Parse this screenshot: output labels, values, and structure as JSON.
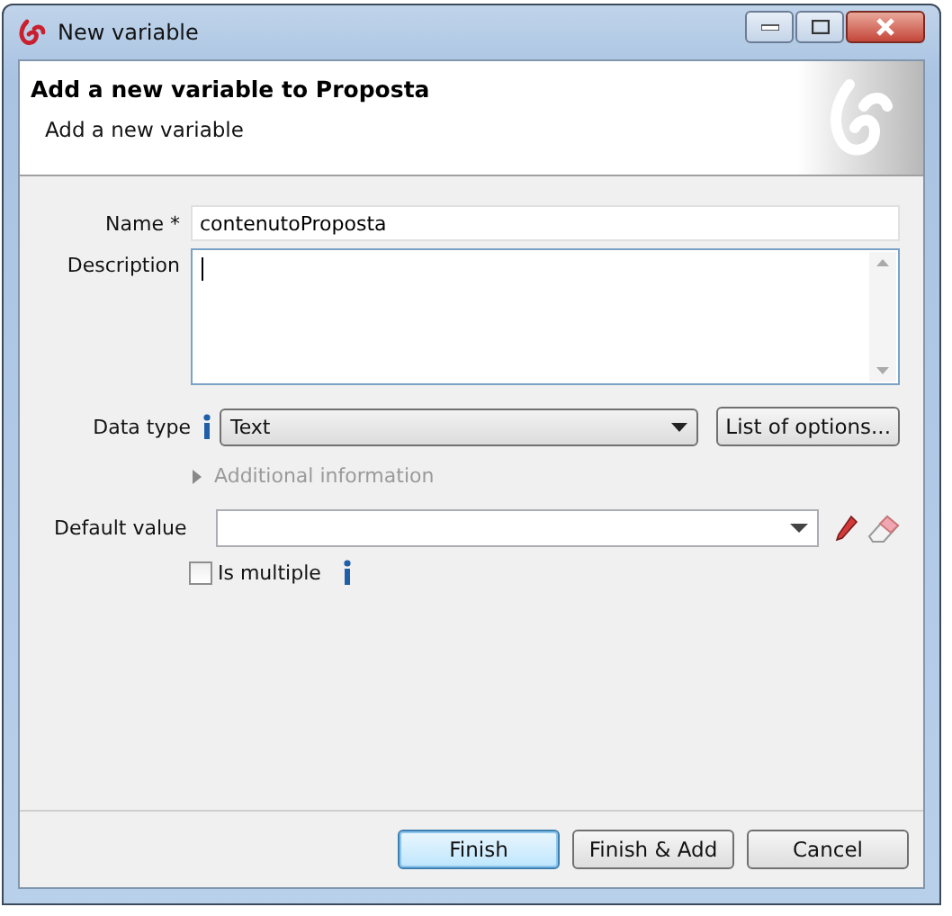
{
  "window": {
    "title": "New variable"
  },
  "header": {
    "title": "Add a new variable to Proposta",
    "subtitle": "Add a new variable"
  },
  "form": {
    "name": {
      "label": "Name *",
      "value": "contenutoProposta"
    },
    "description": {
      "label": "Description",
      "focused": true
    },
    "data_type": {
      "label": "Data type",
      "value": "Text",
      "options_button": "List of options..."
    },
    "additional_information": {
      "label": "Additional information",
      "expanded": false
    },
    "default_value": {
      "label": "Default value"
    },
    "is_multiple": {
      "label": "Is multiple",
      "checked": false
    }
  },
  "buttons": [
    {
      "label": "Finish",
      "default": true
    },
    {
      "label": "Finish & Add",
      "default": false
    },
    {
      "label": "Cancel",
      "default": false
    }
  ]
}
